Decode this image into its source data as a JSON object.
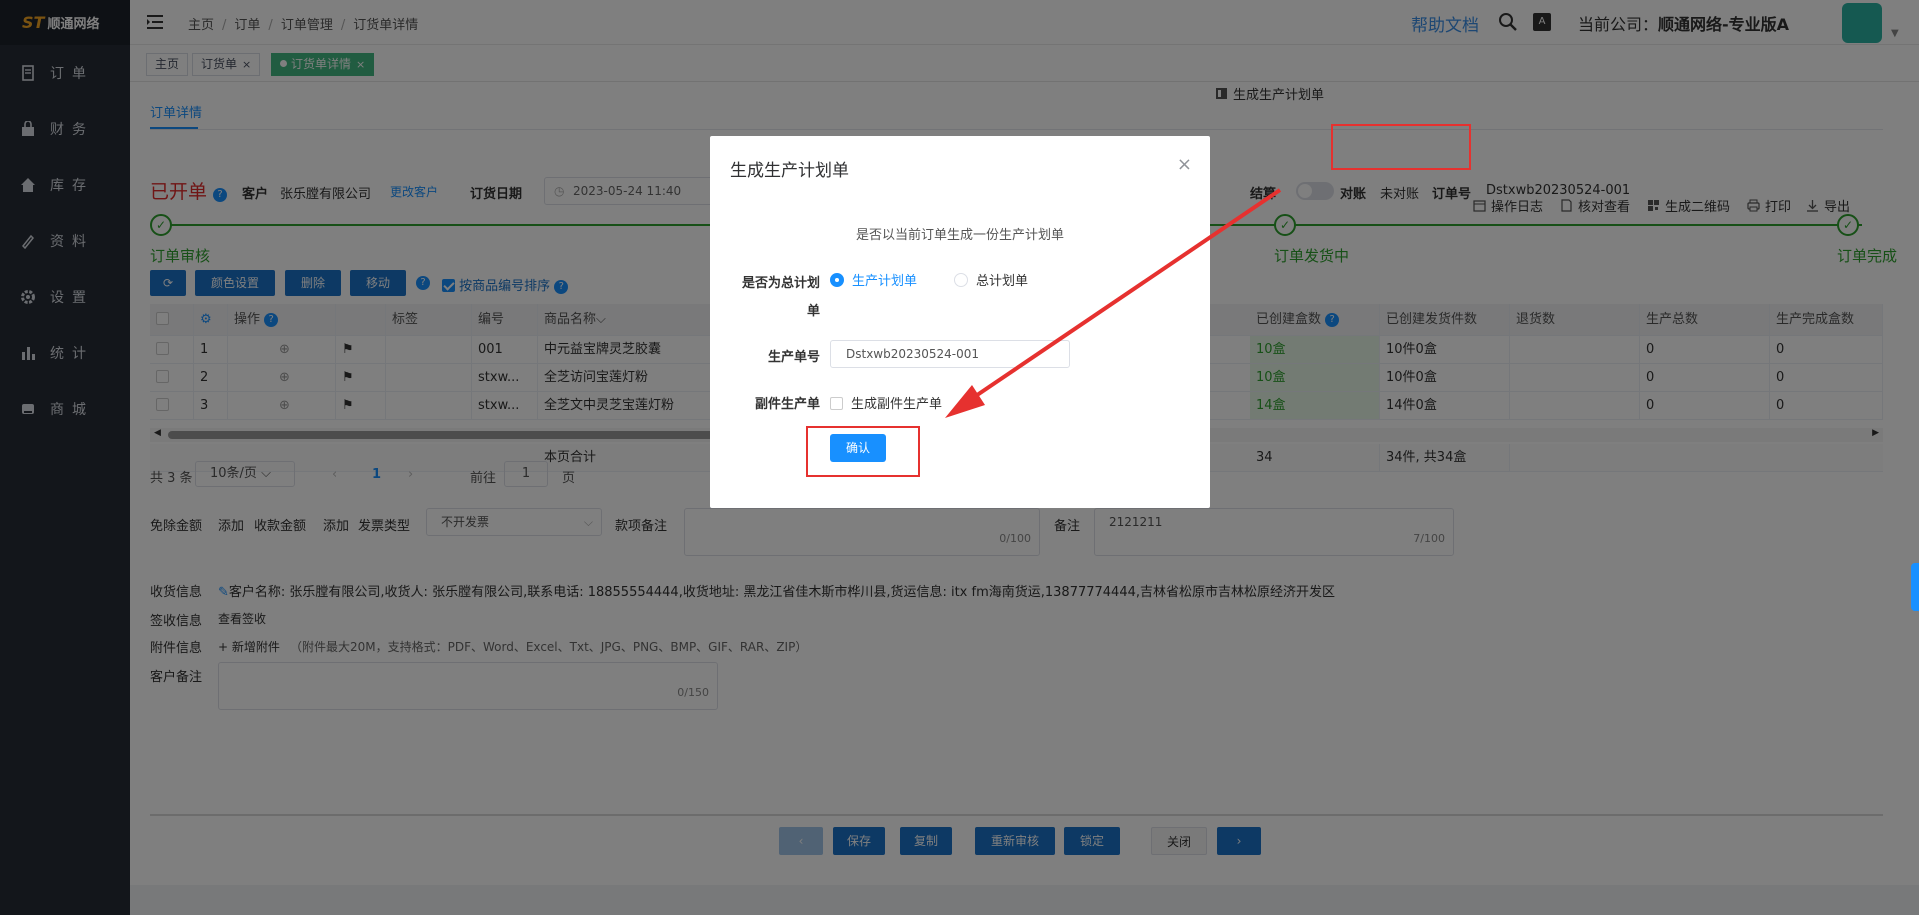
{
  "logo": {
    "mark": "ST",
    "name": "顺通网络"
  },
  "sidebar": {
    "items": [
      {
        "label": "订单",
        "icon": "order-icon"
      },
      {
        "label": "财务",
        "icon": "finance-icon"
      },
      {
        "label": "库存",
        "icon": "inventory-icon"
      },
      {
        "label": "资料",
        "icon": "data-icon"
      },
      {
        "label": "设置",
        "icon": "settings-icon"
      },
      {
        "label": "统计",
        "icon": "stats-icon"
      },
      {
        "label": "商城",
        "icon": "mall-icon"
      }
    ]
  },
  "header": {
    "breadcrumb": [
      "主页",
      "订单",
      "订单管理",
      "订货单详情"
    ],
    "help": "帮助文档",
    "company_label": "当前公司：",
    "company_name": "顺通网络-专业版A"
  },
  "tags": [
    {
      "label": "主页"
    },
    {
      "label": "订货单",
      "close": "×"
    },
    {
      "label": "订货单详情",
      "close": "×"
    }
  ],
  "subtab": "订单详情",
  "toolbar": {
    "items": [
      "生成生产计划单",
      "操作日志",
      "核对查看",
      "生成二维码",
      "打印",
      "导出"
    ]
  },
  "status": {
    "title": "已开单",
    "customer_label": "客户",
    "customer": "张乐膛有限公司",
    "change_customer": "更改客户",
    "date_label": "订货日期",
    "date": "2023-05-24 11:40",
    "settle_label": "结算",
    "reconcile_label": "对账",
    "reconcile_value": "未对账",
    "order_no_label": "订单号",
    "order_no": "Dstxwb20230524-001"
  },
  "steps": [
    "订单审核",
    "订单发货中",
    "订单完成"
  ],
  "buttons": {
    "color_setting": "颜色设置",
    "delete": "删除",
    "move": "移动",
    "sort_by_code": "按商品编号排序"
  },
  "table": {
    "headers": [
      "操作",
      "标签",
      "编号",
      "商品名称",
      "已创建盒数",
      "已创建发货件数",
      "退货数",
      "生产总数",
      "生产完成盒数"
    ],
    "rows": [
      {
        "idx": "1",
        "code": "001",
        "name": "中元益宝牌灵芝胶囊",
        "boxes": "10盒",
        "pieces": "10件0盒",
        "returns": "",
        "total": "0",
        "done": "0"
      },
      {
        "idx": "2",
        "code": "stxw...",
        "name": "全芝访问宝莲灯粉",
        "boxes": "10盒",
        "pieces": "10件0盒",
        "returns": "",
        "total": "0",
        "done": "0"
      },
      {
        "idx": "3",
        "code": "stxw...",
        "name": "全芝文中灵芝宝莲灯粉",
        "boxes": "14盒",
        "pieces": "14件0盒",
        "returns": "",
        "total": "0",
        "done": "0"
      }
    ],
    "summary_label": "本页合计",
    "summary_boxes": "34",
    "summary_pieces": "34件, 共34盒"
  },
  "pager": {
    "total": "共 3 条",
    "page_size": "10条/页",
    "current": "1",
    "goto_label": "前往",
    "goto_value": "1",
    "page_unit": "页"
  },
  "form": {
    "waiver_label": "免除金额",
    "add1": "添加",
    "received_label": "收款金额",
    "add2": "添加",
    "invoice_label": "发票类型",
    "invoice_value": "不开发票",
    "payment_note_label": "款项备注",
    "payment_note_counter": "0/100",
    "remark_label": "备注",
    "remark_value": "2121211",
    "remark_counter": "7/100",
    "receipt_label": "收货信息",
    "receipt_value": "客户名称: 张乐膛有限公司,收货人: 张乐膛有限公司,联系电话: 18855554444,收货地址: 黑龙江省佳木斯市桦川县,货运信息: itx fm海南货运,13877774444,吉林省松原市吉林松原经济开发区",
    "sign_label": "签收信息",
    "sign_link": "查看签收",
    "attach_label": "附件信息",
    "attach_link": "+ 新增附件",
    "attach_hint": "（附件最大20M，支持格式：PDF、Word、Excel、Txt、JPG、PNG、BMP、GIF、RAR、ZIP）",
    "customer_note_label": "客户备注",
    "customer_note_counter": "0/150"
  },
  "footer": {
    "prev": "‹",
    "save": "保存",
    "copy": "复制",
    "re_audit": "重新审核",
    "lock": "锁定",
    "close": "关闭",
    "next": "›"
  },
  "modal": {
    "title": "生成生产计划单",
    "close": "×",
    "message": "是否以当前订单生成一份生产计划单",
    "is_master_label": "是否为总计划单",
    "option_production": "生产计划单",
    "option_master": "总计划单",
    "prod_no_label": "生产单号",
    "prod_no_value": "Dstxwb20230524-001",
    "sub_label": "副件生产单",
    "sub_option": "生成副件生产单",
    "confirm": "确认"
  },
  "colors": {
    "accent": "#1890ff",
    "success": "#2ea12e",
    "danger": "#e02b2b",
    "annotation": "#e6312f"
  }
}
